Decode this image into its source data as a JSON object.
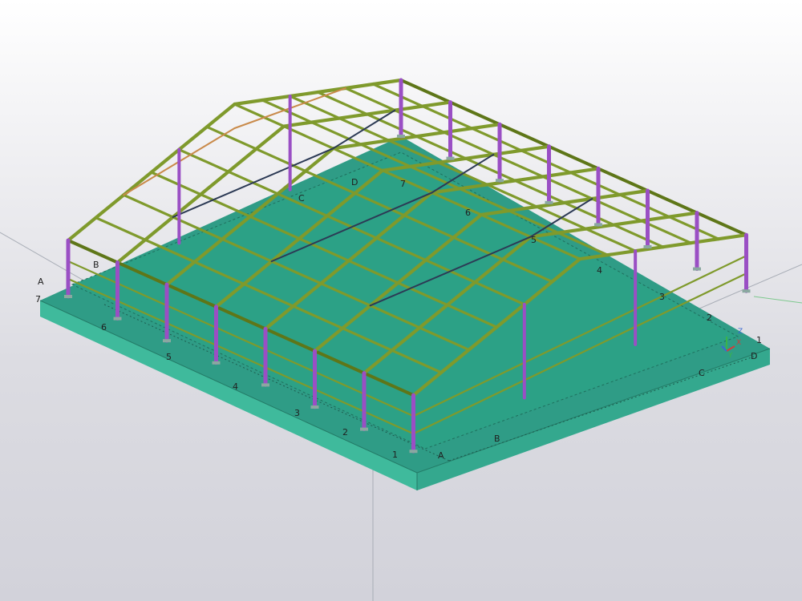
{
  "colors": {
    "slab_top": "#2f9c86",
    "slab_front": "#3fba9c",
    "slab_side": "#34a88e",
    "floor": "#2ea287",
    "steel_beam": "#7f9a2c",
    "steel_beam_dark": "#5e7618",
    "column": "#9a4fc4",
    "bracing": "#c98a4a",
    "grid_line": "#9aa0a8",
    "dark_member": "#2c3a55"
  },
  "icons": {
    "axis_indicator": "xyz-axis-icon"
  },
  "grid_labels": {
    "front_left": [
      "7",
      "6",
      "5",
      "4",
      "3",
      "2",
      "1"
    ],
    "front_right": [
      "A",
      "B",
      "C",
      "D"
    ],
    "left_side": [
      "A",
      "B"
    ],
    "top_inside": [
      "C",
      "D",
      "7",
      "6",
      "5",
      "4",
      "3",
      "2"
    ],
    "right_end": [
      "1"
    ]
  },
  "axis_letters": {
    "x": "X",
    "y": "Y",
    "z": "Z"
  }
}
